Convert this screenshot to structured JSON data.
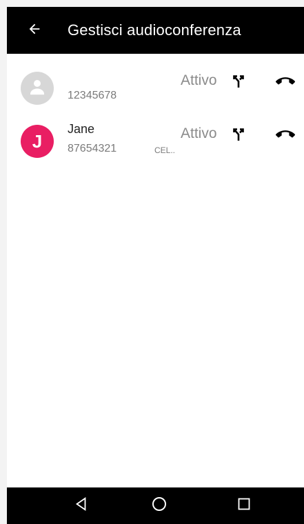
{
  "topbar": {
    "title": "Gestisci audioconferenza",
    "back_icon": "arrow-back-icon"
  },
  "participants": [
    {
      "name": "",
      "number": "12345678",
      "type": "",
      "status": "Attivo",
      "avatar": {
        "kind": "generic-person",
        "letter": "",
        "color": "#d7d7d7"
      },
      "split_icon": "call-split-icon",
      "hangup_icon": "call-end-icon"
    },
    {
      "name": "Jane",
      "number": "87654321",
      "type": "CEL..",
      "status": "Attivo",
      "avatar": {
        "kind": "letter",
        "letter": "J",
        "color": "#e91e63"
      },
      "split_icon": "call-split-icon",
      "hangup_icon": "call-end-icon"
    }
  ],
  "navbar": {
    "back_icon": "nav-back-triangle-icon",
    "home_icon": "nav-home-circle-icon",
    "recents_icon": "nav-recents-square-icon"
  },
  "colors": {
    "topbar": "#000000",
    "navbar": "#000000",
    "avatar_pink": "#e91e63",
    "avatar_generic": "#d7d7d7",
    "status_text": "#8b8b8b"
  }
}
